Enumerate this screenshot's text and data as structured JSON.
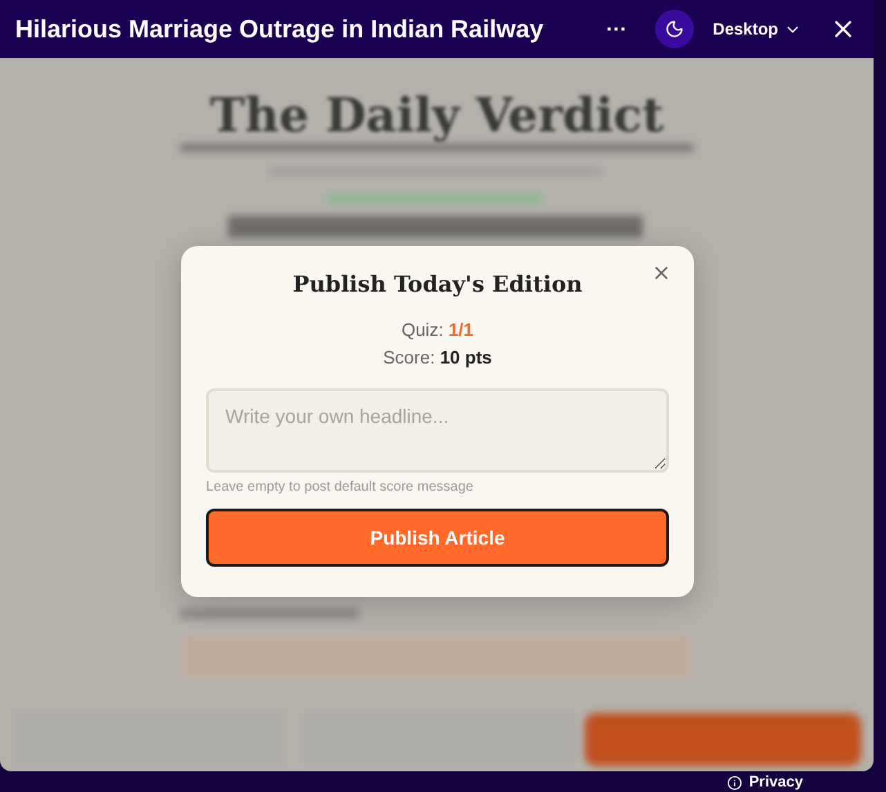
{
  "header": {
    "title": "Hilarious Marriage Outrage in Indian Railway",
    "more": "···",
    "view": "Desktop"
  },
  "page": {
    "masthead": "The Daily Verdict"
  },
  "dialog": {
    "title": "Publish Today's Edition",
    "stats": [
      {
        "label": "Quiz:",
        "value": "1/1",
        "kind": "accent"
      },
      {
        "label": "Score:",
        "value": "10 pts",
        "kind": "strong"
      }
    ],
    "headline": {
      "placeholder": "Write your own headline..."
    },
    "hint": "Leave empty to post default score message",
    "button": "Publish Article"
  },
  "footer": {
    "link": "Privacy"
  }
}
